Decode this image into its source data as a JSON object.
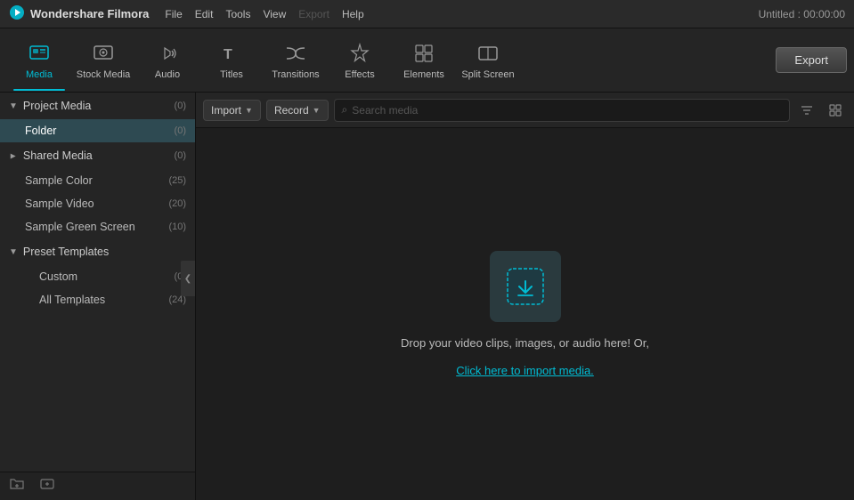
{
  "titlebar": {
    "app_name": "Wondershare Filmora",
    "menu_items": [
      "File",
      "Edit",
      "Tools",
      "View",
      "Export",
      "Help"
    ],
    "export_disabled": "Export",
    "title": "Untitled : 00:00:00"
  },
  "toolbar": {
    "buttons": [
      {
        "id": "media",
        "label": "Media",
        "active": true
      },
      {
        "id": "stock-media",
        "label": "Stock Media",
        "active": false
      },
      {
        "id": "audio",
        "label": "Audio",
        "active": false
      },
      {
        "id": "titles",
        "label": "Titles",
        "active": false
      },
      {
        "id": "transitions",
        "label": "Transitions",
        "active": false
      },
      {
        "id": "effects",
        "label": "Effects",
        "active": false
      },
      {
        "id": "elements",
        "label": "Elements",
        "active": false
      },
      {
        "id": "split-screen",
        "label": "Split Screen",
        "active": false
      }
    ],
    "export_label": "Export"
  },
  "sidebar": {
    "sections": [
      {
        "id": "project-media",
        "label": "Project Media",
        "count": "(0)",
        "expanded": true,
        "children": [
          {
            "id": "folder",
            "label": "Folder",
            "count": "(0)",
            "active": true
          }
        ]
      },
      {
        "id": "shared-media",
        "label": "Shared Media",
        "count": "(0)",
        "expanded": false,
        "children": [
          {
            "id": "sample-color",
            "label": "Sample Color",
            "count": "(25)",
            "active": false
          },
          {
            "id": "sample-video",
            "label": "Sample Video",
            "count": "(20)",
            "active": false
          },
          {
            "id": "sample-green-screen",
            "label": "Sample Green Screen",
            "count": "(10)",
            "active": false
          }
        ]
      },
      {
        "id": "preset-templates",
        "label": "Preset Templates",
        "count": "",
        "expanded": true,
        "children": [
          {
            "id": "custom",
            "label": "Custom",
            "count": "(0)",
            "active": false
          },
          {
            "id": "all-templates",
            "label": "All Templates",
            "count": "(24)",
            "active": false
          }
        ]
      }
    ]
  },
  "content_toolbar": {
    "import_label": "Import",
    "record_label": "Record",
    "search_placeholder": "Search media"
  },
  "drop_zone": {
    "main_text": "Drop your video clips, images, or audio here! Or,",
    "link_text": "Click here to import media."
  },
  "bottom_bar": {
    "add_folder_tooltip": "Add folder",
    "add_media_tooltip": "Add media"
  }
}
